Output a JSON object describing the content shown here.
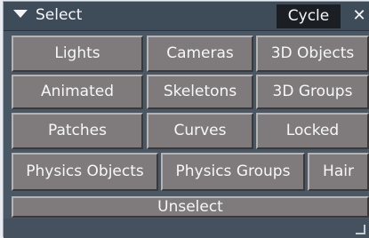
{
  "window": {
    "title": "Select",
    "cycle_label": "Cycle",
    "close_label": "✕"
  },
  "buttons": {
    "row1": [
      "Lights",
      "Cameras",
      "3D Objects"
    ],
    "row2": [
      "Animated",
      "Skeletons",
      "3D Groups"
    ],
    "row3": [
      "Patches",
      "Curves",
      "Locked"
    ],
    "row4": [
      "Physics Objects",
      "Physics Groups",
      "Hair"
    ],
    "unselect": "Unselect"
  },
  "icons": {
    "title_arrow": "dropdown-arrow-icon",
    "close": "close-icon",
    "resize": "resize-grip-icon"
  }
}
